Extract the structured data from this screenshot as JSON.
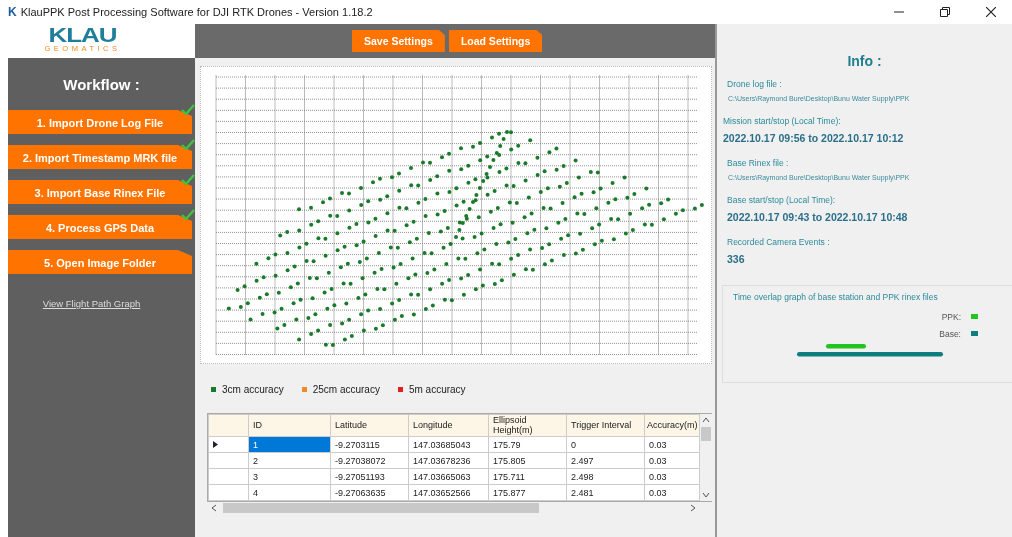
{
  "window": {
    "app_icon": "K",
    "title": "KlauPPK Post Processing Software for DJI RTK Drones - Version 1.18.2"
  },
  "logo": {
    "main": "KLAU",
    "sub": "GEOMATICS"
  },
  "toolbar": {
    "buttons": [
      "Save Settings",
      "Load Settings"
    ]
  },
  "workflow": {
    "title": "Workflow :",
    "steps": [
      {
        "label": "1. Import Drone Log File",
        "done": true
      },
      {
        "label": "2. Import Timestamp MRK file",
        "done": true
      },
      {
        "label": "3. Import Base Rinex File",
        "done": true
      },
      {
        "label": "4. Process GPS Data",
        "done": true
      },
      {
        "label": "5. Open Image Folder",
        "done": false
      }
    ],
    "link": "View Flight Path Graph"
  },
  "legend": [
    {
      "label": "3cm accuracy",
      "color": "#1a7a2a"
    },
    {
      "label": "25cm accuracy",
      "color": "#f08a24"
    },
    {
      "label": "5m accuracy",
      "color": "#e02020"
    }
  ],
  "table": {
    "columns": [
      "ID",
      "Latitude",
      "Longitude",
      "Ellipsoid Height(m)",
      "Trigger Interval",
      "Accuracy(m)"
    ],
    "rows": [
      {
        "selected": true,
        "cells": [
          "1",
          "-9.2703115",
          "147.03685043",
          "175.79",
          "0",
          "0.03"
        ]
      },
      {
        "selected": false,
        "cells": [
          "2",
          "-9.27038072",
          "147.03678236",
          "175.805",
          "2.497",
          "0.03"
        ]
      },
      {
        "selected": false,
        "cells": [
          "3",
          "-9.27051193",
          "147.03665063",
          "175.711",
          "2.498",
          "0.03"
        ]
      },
      {
        "selected": false,
        "cells": [
          "4",
          "-9.27063635",
          "147.03652566",
          "175.877",
          "2.481",
          "0.03"
        ]
      }
    ]
  },
  "info": {
    "title": "Info :",
    "fields": [
      {
        "kind": "path",
        "label": "Drone log file :",
        "value": "C:\\Users\\Raymond Bure\\Desktop\\Bunu Water Supply\\PPK"
      },
      {
        "kind": "time",
        "label": "Mission start/stop (Local Time):",
        "value": "2022.10.17 09:56 to 2022.10.17 10:12"
      },
      {
        "kind": "path",
        "label": "Base Rinex file :",
        "value": "C:\\Users\\Raymond Bure\\Desktop\\Bunu Water Supply\\PPK"
      },
      {
        "kind": "time",
        "label": "Base start/stop (Local Time):",
        "value": "2022.10.17 09:43 to 2022.10.17 10:48"
      },
      {
        "kind": "count",
        "label": "Recorded Camera Events :",
        "value": "336"
      }
    ]
  },
  "overlap": {
    "title": "Time overlap graph of base station and PPK rinex files",
    "series": [
      {
        "label": "PPK:",
        "color": "#22c422"
      },
      {
        "label": "Base:",
        "color": "#0e7d80"
      }
    ]
  }
}
